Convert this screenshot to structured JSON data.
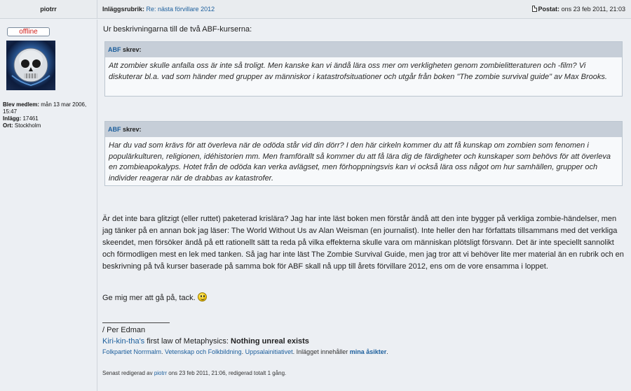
{
  "header": {
    "author": "piotrr",
    "subject_label": "Inläggsrubrik:",
    "subject": "Re: nästa förvillare 2012",
    "posted_label": "Postat:",
    "posted": "ons 23 feb 2011, 21:03"
  },
  "author": {
    "status": "offline",
    "member_label": "Blev medlem:",
    "member_since": "mån 13 mar 2006, 15:47",
    "posts_label": "Inlägg:",
    "posts": "17461",
    "location_label": "Ort:",
    "location": "Stockholm"
  },
  "message": {
    "intro": "Ur beskrivningarna till de två ABF-kurserna:",
    "quotes": [
      {
        "name": "ABF",
        "wrote": "skrev:",
        "text": "Att zombier skulle anfalla oss är inte så troligt. Men kanske kan vi ändå lära oss mer om verkligheten genom zombielitteraturen och -film? Vi diskuterar bl.a. vad som händer med grupper av människor i katastrofsituationer och utgår från boken \"The zombie survival guide\" av Max Brooks."
      },
      {
        "name": "ABF",
        "wrote": "skrev:",
        "text": "Har du vad som krävs för att överleva när de odöda står vid din dörr? I den här cirkeln kommer du att få kunskap om zombien som fenomen i populärkulturen, religionen, idéhistorien mm. Men framförallt så kommer du att få lära dig de färdigheter och kunskaper som behövs för att överleva en zombieapokalyps. Hotet från de odöda kan verka avlägset, men förhoppningsvis kan vi också lära oss något om hur samhällen, grupper och individer reagerar när de drabbas av katastrofer."
      }
    ],
    "body": "Är det inte bara glitzigt (eller ruttet) paketerad krislära? Jag har inte läst boken men förstår ändå att den inte bygger på verkliga zombie-händelser, men jag tänker på en annan bok jag läser: The World Without Us av Alan Weisman (en journalist). Inte heller den har författats tillsammans med det verkliga skeendet, men försöker ändå på ett rationellt sätt ta reda på vilka effekterna skulle vara om människan plötsligt försvann. Det är inte speciellt sannolikt och förmodligen mest en lek med tanken. Så jag har inte läst The Zombie Survival Guide, men jag tror att vi behöver lite mer material än en rubrik och en beskrivning på två kurser baserade på samma bok för ABF skall nå upp till årets förvillare 2012, ens om de vore ensamma i loppet.",
    "closing": "Ge mig mer att gå på, tack."
  },
  "signature": {
    "name": "/ Per Edman",
    "law_link": "Kiri-kin-tha's",
    "law_text": " first law of Metaphysics: ",
    "law_bold": "Nothing unreal exists",
    "link1": "Folkpartiet Norrmalm",
    "sep1": ". ",
    "link2": "Vetenskap och Folkbildning",
    "sep2": ". ",
    "link3": "Uppsalainitiativet",
    "tail": ". Inlägget innehåller ",
    "link4": "mina åsikter",
    "end": "."
  },
  "edit_note": {
    "prefix": "Senast redigerad av ",
    "user": "piotrr",
    "suffix": " ons 23 feb 2011, 21:06, redigerad totalt 1 gång."
  }
}
